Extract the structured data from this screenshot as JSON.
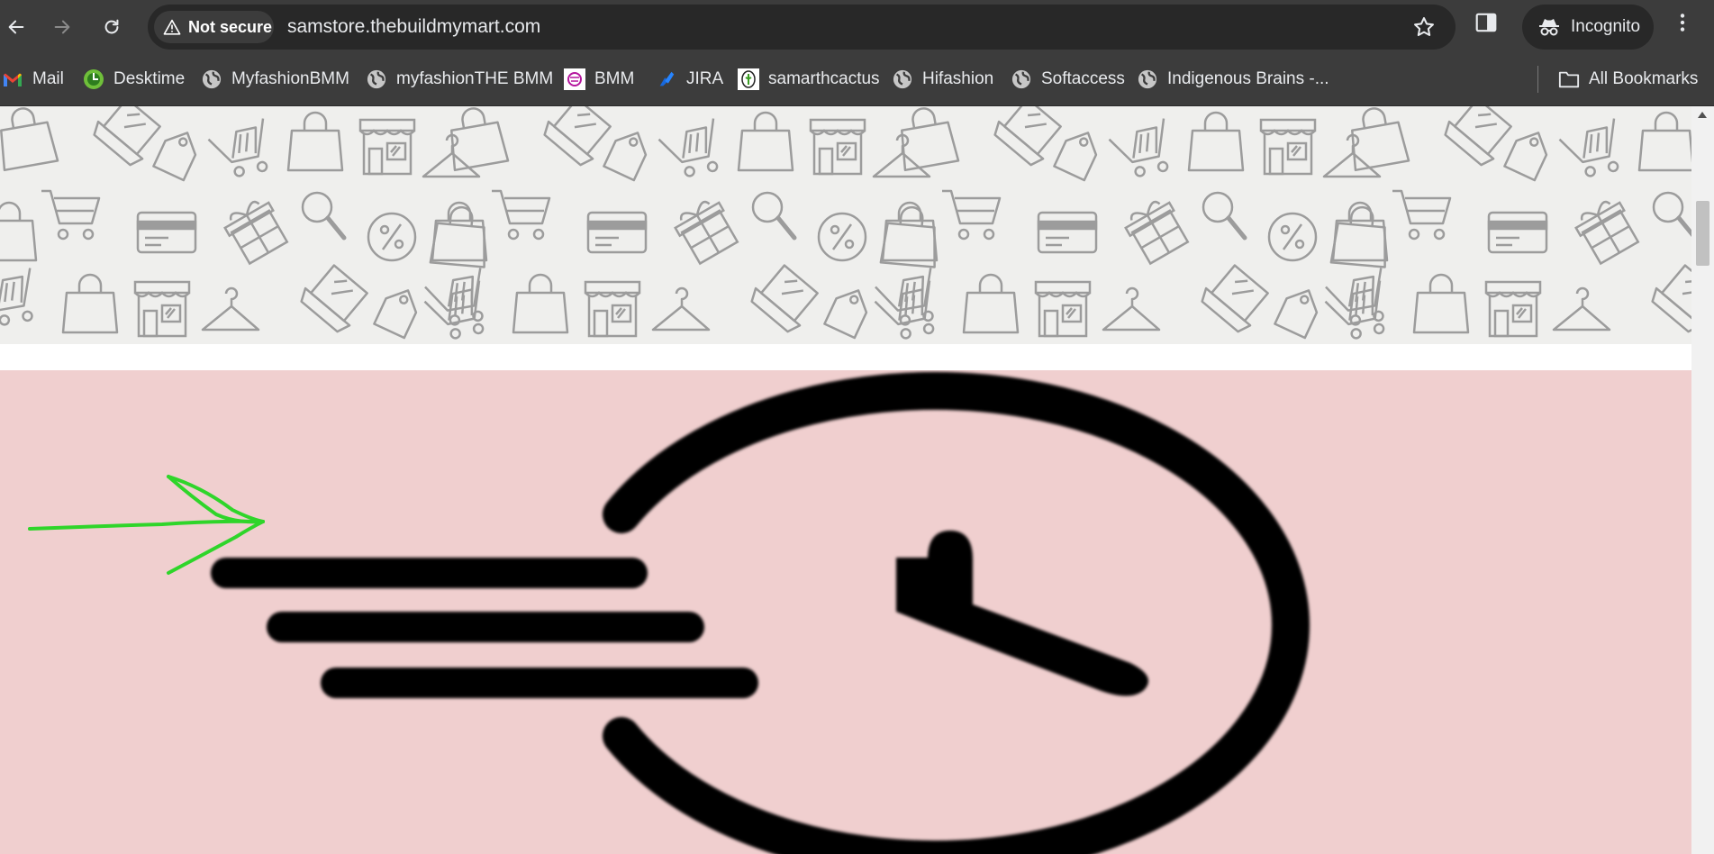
{
  "browser": {
    "security_label": "Not secure",
    "url": "samstore.thebuildmymart.com",
    "profile_label": "Incognito"
  },
  "bookmarks": [
    {
      "label": "Mail",
      "icon": "gmail-icon"
    },
    {
      "label": "Desktime",
      "icon": "desktime-icon"
    },
    {
      "label": "MyfashionBMM",
      "icon": "globe-icon"
    },
    {
      "label": "myfashionTHE BMM",
      "icon": "globe-icon"
    },
    {
      "label": "BMM",
      "icon": "bmm-icon"
    },
    {
      "label": "JIRA",
      "icon": "jira-icon"
    },
    {
      "label": "samarthcactus",
      "icon": "cactus-icon"
    },
    {
      "label": "Hifashion",
      "icon": "globe-icon"
    },
    {
      "label": "Softaccess",
      "icon": "globe-icon"
    },
    {
      "label": "Indigenous Brains -...",
      "icon": "globe-icon"
    }
  ],
  "all_bookmarks_label": "All Bookmarks",
  "colors": {
    "toolbar": "#3c3c3c",
    "banner_bg": "#efefed",
    "pattern_stroke": "#9c9c9c",
    "pink_bg": "#f0cfcf",
    "annotation_arrow": "#2fd52a"
  }
}
